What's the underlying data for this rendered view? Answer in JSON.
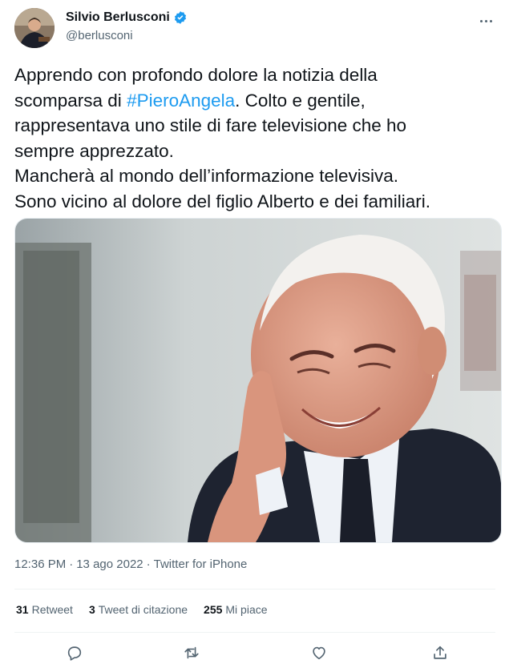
{
  "author": {
    "name": "Silvio Berlusconi",
    "handle": "@berlusconi",
    "avatar_icon": "avatar-photo",
    "verified_icon": "verified-badge-icon"
  },
  "tweet": {
    "line1": "Apprendo con profondo dolore la notizia della",
    "line2_pre": "scomparsa di ",
    "hashtag": "#PieroAngela",
    "line2_post": ". Colto e gentile,",
    "line3": "rappresentava uno stile di fare televisione che ho",
    "line4": "sempre apprezzato.",
    "line5": "Mancherà al mondo dell’informazione televisiva.",
    "line6": "Sono vicino al dolore del figlio Alberto e dei familiari."
  },
  "meta": {
    "time": "12:36 PM",
    "date": "13 ago 2022",
    "source": "Twitter for iPhone",
    "separator": "·"
  },
  "stats": {
    "retweets_count": "31",
    "retweets_label": "Retweet",
    "quotes_count": "3",
    "quotes_label": "Tweet di citazione",
    "likes_count": "255",
    "likes_label": "Mi piace"
  },
  "actions": [
    "reply-icon",
    "retweet-icon",
    "like-icon",
    "share-icon"
  ],
  "colors": {
    "link": "#1d9bf0",
    "secondary_text": "#536471",
    "primary_text": "#0f1419"
  }
}
